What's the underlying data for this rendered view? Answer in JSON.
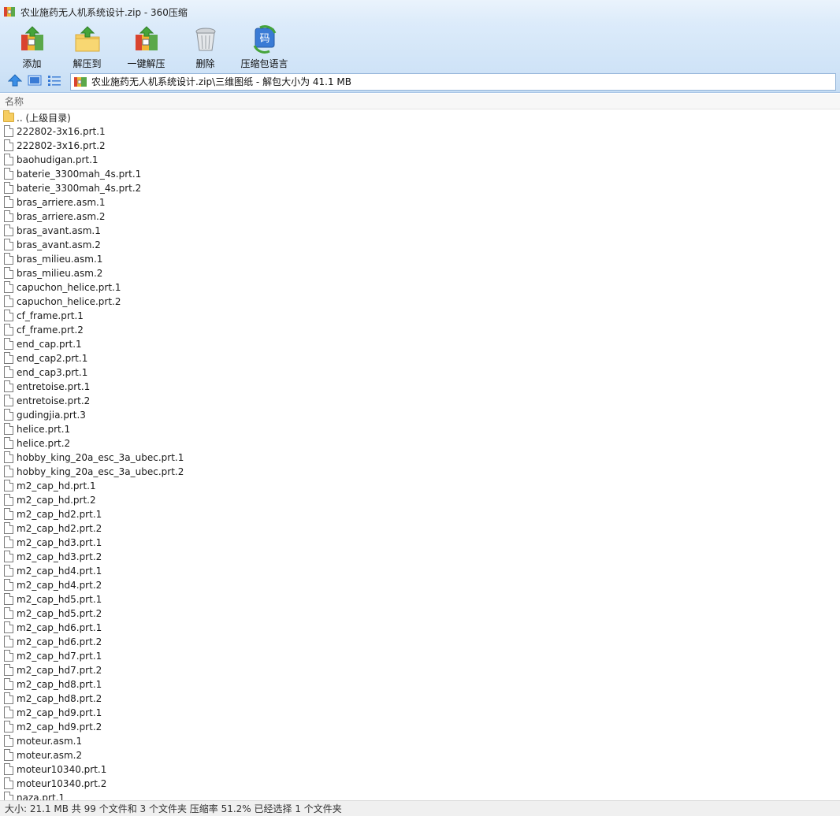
{
  "window": {
    "title": "农业施药无人机系统设计.zip - 360压缩"
  },
  "toolbar": {
    "items": [
      {
        "label": "添加",
        "icon": "add-archive-icon"
      },
      {
        "label": "解压到",
        "icon": "extract-to-icon"
      },
      {
        "label": "一键解压",
        "icon": "one-click-extract-icon"
      },
      {
        "label": "删除",
        "icon": "delete-trash-icon"
      },
      {
        "label": "压缩包语言",
        "icon": "archive-language-icon"
      }
    ],
    "lang_glyph": "码"
  },
  "address": {
    "path": "农业施药无人机系统设计.zip\\三维图纸 - 解包大小为 41.1 MB"
  },
  "columns": {
    "name": "名称"
  },
  "files": [
    {
      "name": ".. (上级目录)",
      "type": "folder"
    },
    {
      "name": "222802-3x16.prt.1",
      "type": "file"
    },
    {
      "name": "222802-3x16.prt.2",
      "type": "file"
    },
    {
      "name": "baohudigan.prt.1",
      "type": "file"
    },
    {
      "name": "baterie_3300mah_4s.prt.1",
      "type": "file"
    },
    {
      "name": "baterie_3300mah_4s.prt.2",
      "type": "file"
    },
    {
      "name": "bras_arriere.asm.1",
      "type": "file"
    },
    {
      "name": "bras_arriere.asm.2",
      "type": "file"
    },
    {
      "name": "bras_avant.asm.1",
      "type": "file"
    },
    {
      "name": "bras_avant.asm.2",
      "type": "file"
    },
    {
      "name": "bras_milieu.asm.1",
      "type": "file"
    },
    {
      "name": "bras_milieu.asm.2",
      "type": "file"
    },
    {
      "name": "capuchon_helice.prt.1",
      "type": "file"
    },
    {
      "name": "capuchon_helice.prt.2",
      "type": "file"
    },
    {
      "name": "cf_frame.prt.1",
      "type": "file"
    },
    {
      "name": "cf_frame.prt.2",
      "type": "file"
    },
    {
      "name": "end_cap.prt.1",
      "type": "file"
    },
    {
      "name": "end_cap2.prt.1",
      "type": "file"
    },
    {
      "name": "end_cap3.prt.1",
      "type": "file"
    },
    {
      "name": "entretoise.prt.1",
      "type": "file"
    },
    {
      "name": "entretoise.prt.2",
      "type": "file"
    },
    {
      "name": "gudingjia.prt.3",
      "type": "file"
    },
    {
      "name": "helice.prt.1",
      "type": "file"
    },
    {
      "name": "helice.prt.2",
      "type": "file"
    },
    {
      "name": "hobby_king_20a_esc_3a_ubec.prt.1",
      "type": "file"
    },
    {
      "name": "hobby_king_20a_esc_3a_ubec.prt.2",
      "type": "file"
    },
    {
      "name": "m2_cap_hd.prt.1",
      "type": "file"
    },
    {
      "name": "m2_cap_hd.prt.2",
      "type": "file"
    },
    {
      "name": "m2_cap_hd2.prt.1",
      "type": "file"
    },
    {
      "name": "m2_cap_hd2.prt.2",
      "type": "file"
    },
    {
      "name": "m2_cap_hd3.prt.1",
      "type": "file"
    },
    {
      "name": "m2_cap_hd3.prt.2",
      "type": "file"
    },
    {
      "name": "m2_cap_hd4.prt.1",
      "type": "file"
    },
    {
      "name": "m2_cap_hd4.prt.2",
      "type": "file"
    },
    {
      "name": "m2_cap_hd5.prt.1",
      "type": "file"
    },
    {
      "name": "m2_cap_hd5.prt.2",
      "type": "file"
    },
    {
      "name": "m2_cap_hd6.prt.1",
      "type": "file"
    },
    {
      "name": "m2_cap_hd6.prt.2",
      "type": "file"
    },
    {
      "name": "m2_cap_hd7.prt.1",
      "type": "file"
    },
    {
      "name": "m2_cap_hd7.prt.2",
      "type": "file"
    },
    {
      "name": "m2_cap_hd8.prt.1",
      "type": "file"
    },
    {
      "name": "m2_cap_hd8.prt.2",
      "type": "file"
    },
    {
      "name": "m2_cap_hd9.prt.1",
      "type": "file"
    },
    {
      "name": "m2_cap_hd9.prt.2",
      "type": "file"
    },
    {
      "name": "moteur.asm.1",
      "type": "file"
    },
    {
      "name": "moteur.asm.2",
      "type": "file"
    },
    {
      "name": "moteur10340.prt.1",
      "type": "file"
    },
    {
      "name": "moteur10340.prt.2",
      "type": "file"
    },
    {
      "name": "naza.prt.1",
      "type": "file"
    }
  ],
  "status": {
    "text": "大小: 21.1 MB 共 99 个文件和 3 个文件夹 压缩率 51.2% 已经选择 1 个文件夹"
  },
  "colors": {
    "toolbar_top": "#dcebfa",
    "toolbar_bottom": "#cfe3f7",
    "accent": "#3a7bd5"
  }
}
